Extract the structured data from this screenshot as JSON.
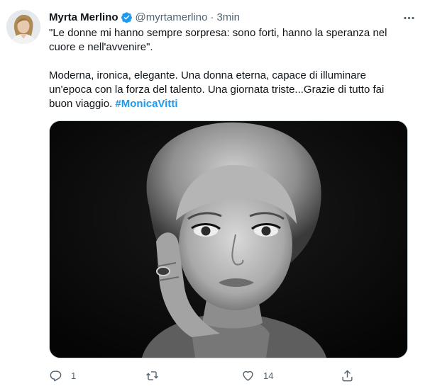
{
  "tweet": {
    "display_name": "Myrta Merlino",
    "handle": "@myrtamerlino",
    "separator": "·",
    "time": "3min",
    "paragraph1_line1": "\"Le donne mi hanno sempre sorpresa: sono forti, hanno la speranza nel",
    "paragraph1_line2": "cuore e nell'avvenire\".",
    "paragraph2_line1": "Moderna, ironica, elegante. Una donna eterna, capace di illuminare",
    "paragraph2_line2": "un'epoca con la forza del talento. Una giornata triste...Grazie di tutto fai",
    "paragraph2_line3_prefix": "buon viaggio. ",
    "hashtag": "#MonicaVitti"
  },
  "icons": {
    "verified": "verified-badge-icon",
    "more": "more-icon",
    "reply": "reply-icon",
    "retweet": "retweet-icon",
    "like": "like-icon",
    "share": "share-icon"
  },
  "actions": {
    "reply_count": "1",
    "retweet_count": "",
    "like_count": "14"
  },
  "colors": {
    "accent": "#1d9bf0",
    "secondary_text": "#536471",
    "primary_text": "#0f1419"
  }
}
